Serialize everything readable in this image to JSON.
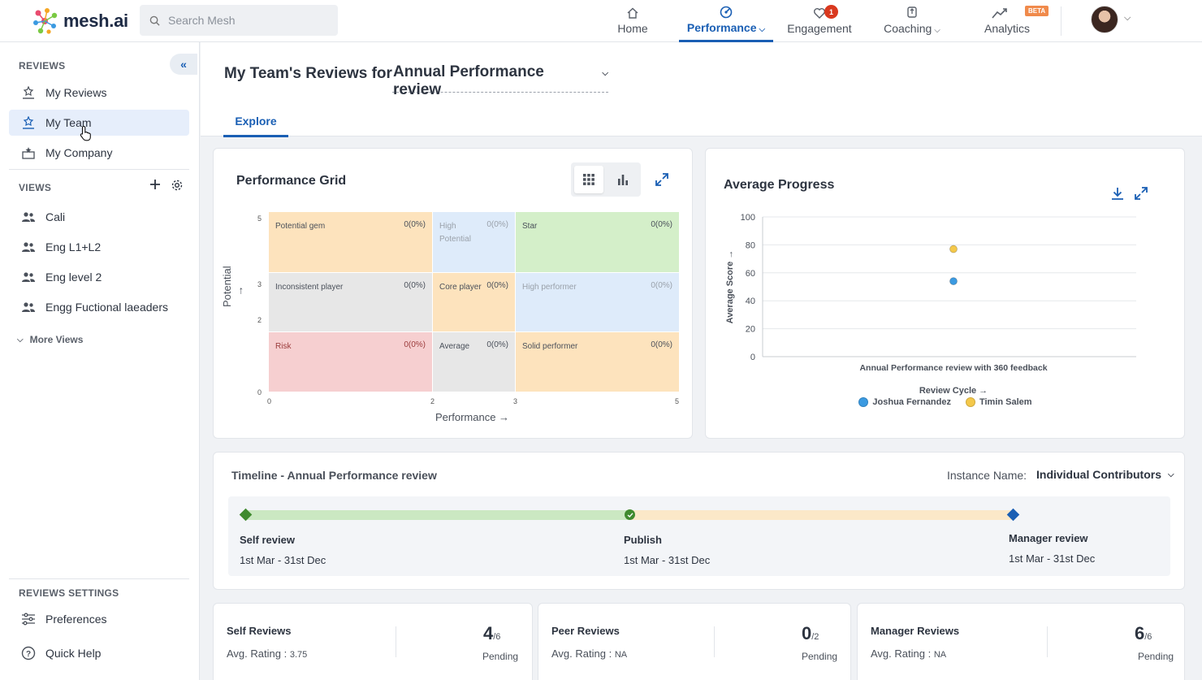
{
  "brand": {
    "name": "mesh.ai"
  },
  "search": {
    "placeholder": "Search Mesh"
  },
  "nav": {
    "home": "Home",
    "performance": "Performance",
    "engagement": "Engagement",
    "engagement_badge": "1",
    "coaching": "Coaching",
    "analytics": "Analytics",
    "analytics_badge": "BETA"
  },
  "sidebar": {
    "reviews_title": "REVIEWS",
    "reviews": [
      {
        "label": "My Reviews",
        "icon": "reviews-icon"
      },
      {
        "label": "My Team",
        "icon": "team-review-icon"
      },
      {
        "label": "My Company",
        "icon": "company-icon"
      }
    ],
    "views_title": "VIEWS",
    "views": [
      {
        "label": "Cali"
      },
      {
        "label": "Eng L1+L2"
      },
      {
        "label": "Eng level 2"
      },
      {
        "label": "Engg Fuctional laeaders"
      }
    ],
    "more_views": "More Views",
    "settings_title": "REVIEWS SETTINGS",
    "preferences": "Preferences",
    "quick_help": "Quick Help"
  },
  "header": {
    "title": "My Team's Reviews for",
    "review_cycle": "Annual Performance review",
    "tab": "Explore"
  },
  "performance_grid": {
    "title": "Performance Grid",
    "x_label": "Performance →",
    "y_label": "Potential →",
    "x_ticks": [
      "0",
      "2",
      "3",
      "5"
    ],
    "y_ticks": [
      "5",
      "3",
      "2",
      "0"
    ],
    "cells": [
      {
        "label": "Potential gem",
        "value": "0(0%)",
        "color": "#fde3bd"
      },
      {
        "label": "High Potential",
        "value": "0(0%)",
        "color": "#deebfa"
      },
      {
        "label": "Star",
        "value": "0(0%)",
        "color": "#d4efc9"
      },
      {
        "label": "Inconsistent player",
        "value": "0(0%)",
        "color": "#e7e7e7"
      },
      {
        "label": "Core player",
        "value": "0(0%)",
        "color": "#fde3bd"
      },
      {
        "label": "High performer",
        "value": "0(0%)",
        "color": "#deebfa"
      },
      {
        "label": "Risk",
        "value": "0(0%)",
        "color": "#f6cfd0"
      },
      {
        "label": "Average",
        "value": "0(0%)",
        "color": "#e7e7e7"
      },
      {
        "label": "Solid performer",
        "value": "0(0%)",
        "color": "#fde3bd"
      }
    ]
  },
  "chart_data": {
    "type": "scatter",
    "title": "Average Progress",
    "xlabel": "Review Cycle →",
    "ylabel": "Average Score →",
    "categories": [
      "Annual Performance review with 360 feedback"
    ],
    "ylim": [
      0,
      100
    ],
    "y_ticks": [
      0,
      20,
      40,
      60,
      80,
      100
    ],
    "grid": true,
    "legend": "bottom",
    "series": [
      {
        "name": "Joshua Fernandez",
        "values": [
          54
        ],
        "color": "#3b9ae1"
      },
      {
        "name": "Timin Salem",
        "values": [
          77
        ],
        "color": "#f4c84a"
      }
    ]
  },
  "timeline": {
    "title": "Timeline - Annual Performance review",
    "instance_label": "Instance Name:",
    "instance_value": "Individual Contributors",
    "stages": [
      {
        "label": "Self review",
        "dates": "1st Mar - 31st Dec"
      },
      {
        "label": "Publish",
        "dates": "1st Mar - 31st Dec"
      },
      {
        "label": "Manager review",
        "dates": "1st Mar - 31st Dec"
      }
    ]
  },
  "stats": [
    {
      "title": "Self Reviews",
      "rating_label": "Avg. Rating :",
      "rating": "3.75",
      "count": "4",
      "total": "/6",
      "status": "Pending"
    },
    {
      "title": "Peer Reviews",
      "rating_label": "Avg. Rating :",
      "rating": "NA",
      "count": "0",
      "total": "/2",
      "status": "Pending"
    },
    {
      "title": "Manager Reviews",
      "rating_label": "Avg. Rating :",
      "rating": "NA",
      "count": "6",
      "total": "/6",
      "status": "Pending"
    }
  ]
}
